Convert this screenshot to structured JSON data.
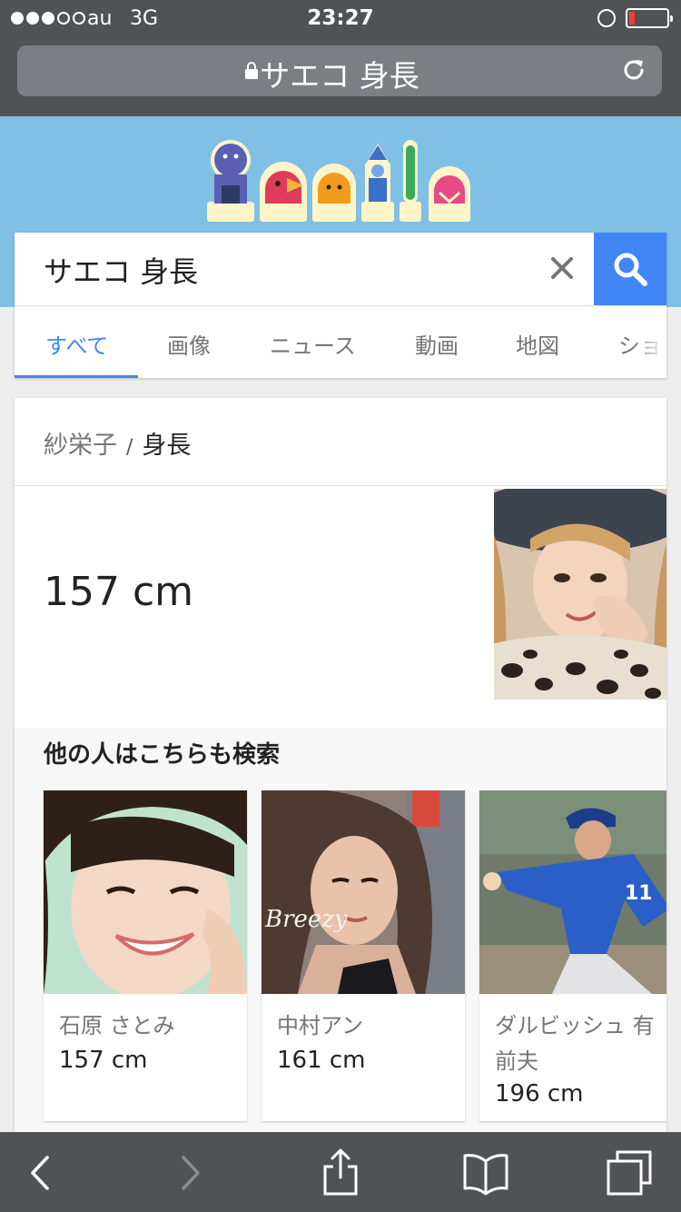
{
  "status": {
    "signal_filled": 3,
    "signal_total": 5,
    "carrier": "au",
    "network": "3G",
    "time": "23:27",
    "battery_level": 0.15
  },
  "browser": {
    "url_text": "サエコ 身長",
    "icons": [
      "lock-icon",
      "reload-icon"
    ]
  },
  "search": {
    "query": "サエコ 身長",
    "tabs": [
      "すべて",
      "画像",
      "ニュース",
      "動画",
      "地図",
      "ショ"
    ],
    "active_tab": 0,
    "icons": [
      "close-icon",
      "search-icon"
    ]
  },
  "result": {
    "entity": "紗栄子",
    "separator": "/",
    "attribute": "身長",
    "value": "157 cm"
  },
  "people_also_search": {
    "title": "他の人はこちらも検索",
    "people": [
      {
        "name": "石原 さとみ",
        "height": "157 cm"
      },
      {
        "name": "中村アン",
        "height": "161 cm"
      },
      {
        "name": "ダルビッシュ 有前夫",
        "height": "196 cm"
      }
    ]
  },
  "toolbar": {
    "icons": [
      "back-icon",
      "forward-icon",
      "share-icon",
      "bookmarks-icon",
      "tabs-icon"
    ]
  },
  "colors": {
    "google_blue": "#4285f4",
    "doodle_sky": "#80c0e4",
    "chrome_dark": "#505355",
    "battery_red": "#ff3b30"
  }
}
